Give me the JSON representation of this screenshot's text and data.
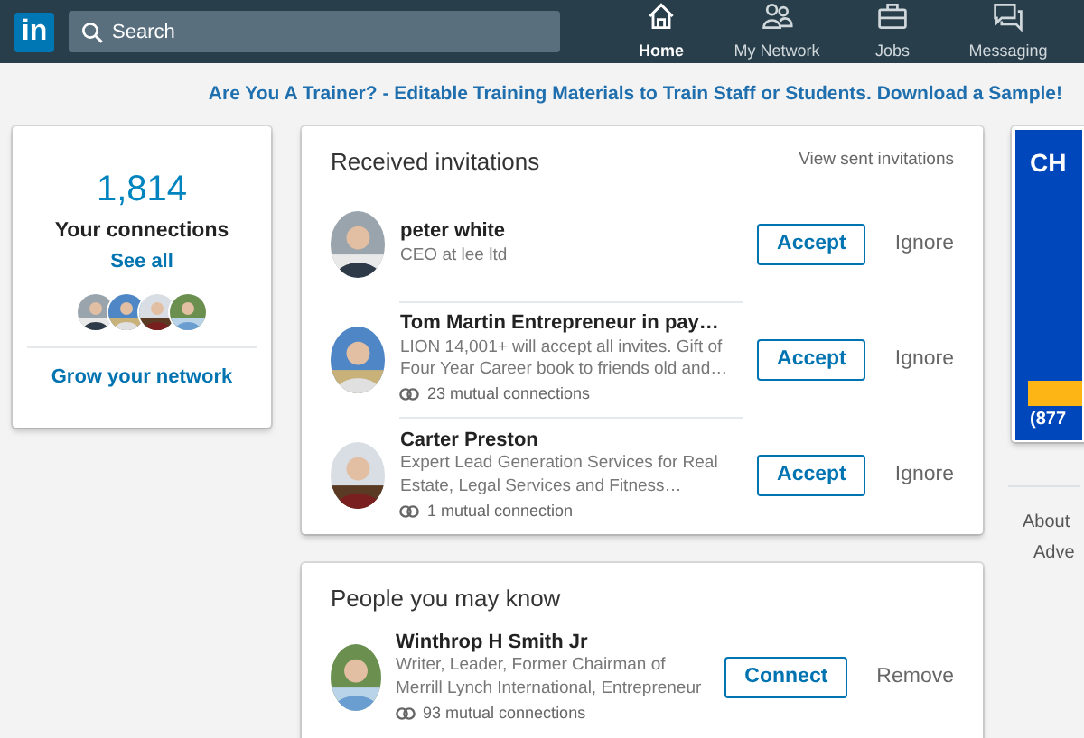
{
  "logo": "in",
  "search": {
    "placeholder": "Search"
  },
  "nav": [
    {
      "label": "Home",
      "selected": true
    },
    {
      "label": "My Network",
      "selected": false
    },
    {
      "label": "Jobs",
      "selected": false
    },
    {
      "label": "Messaging",
      "selected": false
    }
  ],
  "promo": "Are You A Trainer? - Editable Training Materials to Train Staff or Students. Download a Sample!",
  "connections": {
    "count": "1,814",
    "label": "Your connections",
    "link": "See all",
    "grow": "Grow your network"
  },
  "invitations": {
    "title": "Received invitations",
    "link": "View sent invitations",
    "items": [
      {
        "name": "peter white",
        "headline": "CEO at lee ltd",
        "accept": "Accept",
        "ignore": "Ignore"
      },
      {
        "name": "Tom Martin Entrepreneur in pay…",
        "headline": "LION 14,001+ will accept all invites. Gift of Four Year Career book to friends old and…",
        "mutual": "23 mutual connections",
        "accept": "Accept",
        "ignore": "Ignore"
      },
      {
        "name": "Carter Preston",
        "headline": "Expert Lead Generation Services for Real Estate, Legal Services and Fitness…",
        "mutual": "1 mutual connection",
        "accept": "Accept",
        "ignore": "Ignore"
      }
    ]
  },
  "pymk": {
    "title": "People you may know",
    "items": [
      {
        "name": "Winthrop H Smith Jr",
        "headline": "Writer, Leader, Former Chairman of Merrill Lynch International, Entrepreneur",
        "mutual": "93 mutual connections",
        "connect": "Connect",
        "remove": "Remove"
      }
    ]
  },
  "ad": {
    "heading": "CH",
    "phone": "(877"
  },
  "footer_links": [
    "About",
    "Adve"
  ]
}
